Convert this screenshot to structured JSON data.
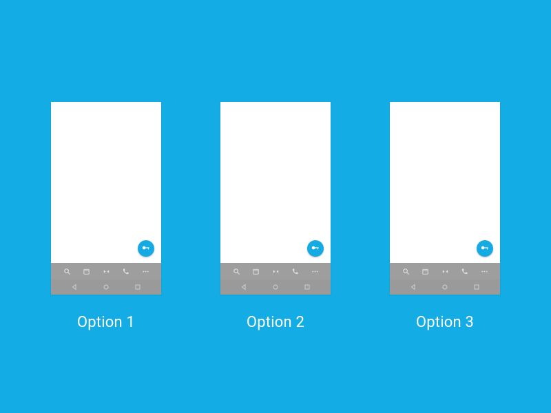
{
  "background_color": "#13ace4",
  "options": [
    {
      "label": "Option 1"
    },
    {
      "label": "Option 2"
    },
    {
      "label": "Option 3"
    }
  ],
  "fab": {
    "icon": "key-icon",
    "color": "#15aae2"
  },
  "appbar_icons": [
    "search-icon",
    "calendar-icon",
    "bowtie-icon",
    "phone-icon",
    "more-icon"
  ],
  "navbar_icons": [
    "back-icon",
    "home-icon",
    "recent-icon"
  ]
}
